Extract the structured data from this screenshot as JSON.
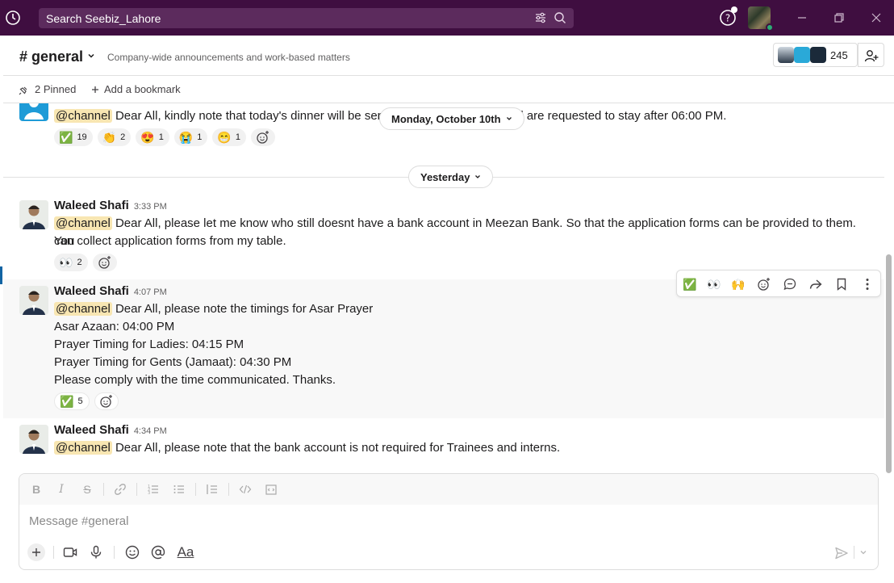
{
  "search": {
    "text": "Search Seebiz_Lahore"
  },
  "channel": {
    "name": "# general",
    "topic": "Company-wide announcements and work-based matters",
    "member_count": "245"
  },
  "bookmarks": {
    "pinned": "2 Pinned",
    "add": "Add a bookmark"
  },
  "top_message": {
    "mention": "@channel",
    "text_before": "Dear All, kindly note that today's dinner will be serv",
    "text_after": "ll are requested to stay after 06:00 PM.",
    "date_pill": "Monday, October 10th",
    "reactions": [
      {
        "emoji": "✅",
        "count": "19"
      },
      {
        "emoji": "👏",
        "count": "2"
      },
      {
        "emoji": "😍",
        "count": "1"
      },
      {
        "emoji": "😭",
        "count": "1"
      },
      {
        "emoji": "😁",
        "count": "1"
      }
    ]
  },
  "divider": {
    "label": "Yesterday"
  },
  "messages": [
    {
      "author": "Waleed Shafi",
      "time": "3:33 PM",
      "mention": "@channel",
      "line1": "Dear All, please let me know who still doesnt have a bank account in Meezan Bank. So that the application forms can be provided to them. You",
      "line2": "can collect application forms from my table.",
      "reaction": {
        "emoji": "👀",
        "count": "2"
      }
    },
    {
      "author": "Waleed Shafi",
      "time": "4:07 PM",
      "mention": "@channel",
      "line1": "Dear All, please note the timings for Asar Prayer",
      "line2": "Asar Azaan: 04:00 PM",
      "line3": "Prayer Timing for Ladies: 04:15 PM",
      "line4": "Prayer Timing for Gents (Jamaat): 04:30 PM",
      "line5": "Please comply with the time communicated. Thanks.",
      "reaction": {
        "emoji": "✅",
        "count": "5"
      }
    },
    {
      "author": "Waleed Shafi",
      "time": "4:34 PM",
      "mention": "@channel",
      "line1": "Dear All, please note that the bank account is not required for Trainees and interns."
    }
  ],
  "hover_actions": [
    {
      "emoji": "✅"
    },
    {
      "emoji": "👀"
    },
    {
      "emoji": "🙌"
    }
  ],
  "composer": {
    "placeholder": "Message #general",
    "format_label": "Aa"
  },
  "colors": {
    "titlebar": "#3f0e40",
    "mention_bg": "#f8e6b2",
    "online": "#2bac76"
  }
}
